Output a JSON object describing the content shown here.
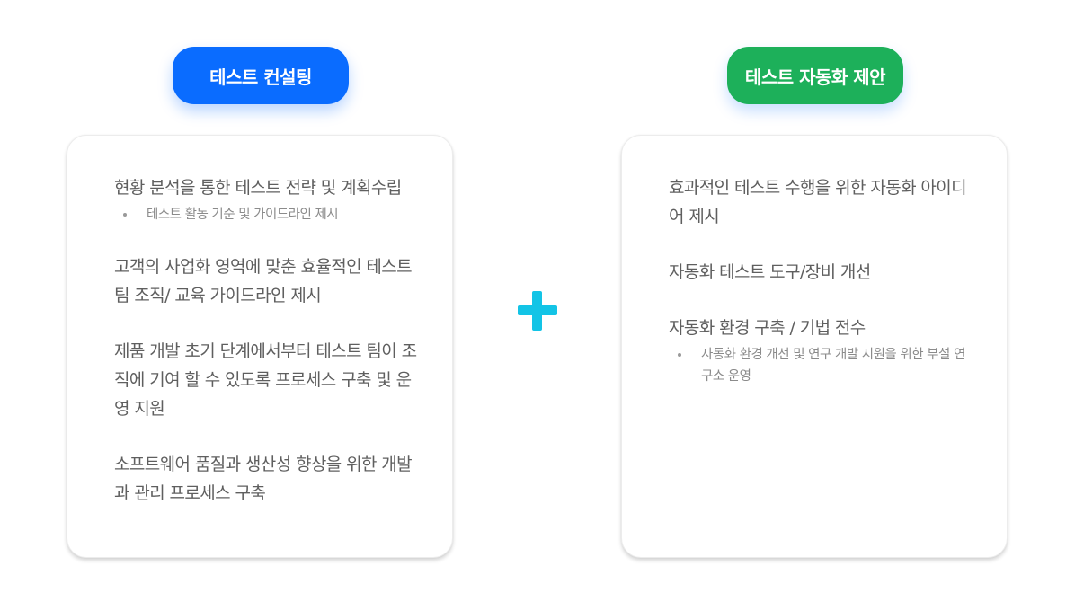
{
  "left": {
    "title": "테스트 컨설팅",
    "items": [
      {
        "text": "현황 분석을 통한 테스트 전략 및 계획수립",
        "subitems": [
          "테스트 활동 기준 및 가이드라인 제시"
        ]
      },
      {
        "text": "고객의 사업화 영역에 맞춘 효율적인 테스트 팀 조직/ 교육 가이드라인 제시"
      },
      {
        "text": "제품 개발 초기 단계에서부터 테스트 팀이 조직에 기여 할 수 있도록 프로세스 구축 및 운영 지원"
      },
      {
        "text": "소프트웨어 품질과 생산성 향상을 위한 개발과 관리 프로세스 구축"
      }
    ]
  },
  "right": {
    "title": "테스트 자동화 제안",
    "items": [
      {
        "text": "효과적인 테스트 수행을 위한 자동화 아이디어 제시"
      },
      {
        "text": "자동화 테스트 도구/장비 개선"
      },
      {
        "text": "자동화 환경 구축 / 기법 전수",
        "subitems": [
          "자동화 환경 개선 및 연구 개발 지원을 위한 부설 연구소 운영"
        ]
      }
    ]
  },
  "colors": {
    "left_accent": "#0a6cff",
    "right_accent": "#1db05a",
    "plus": "#13c4e6"
  },
  "icons": {
    "center": "plus-icon"
  }
}
